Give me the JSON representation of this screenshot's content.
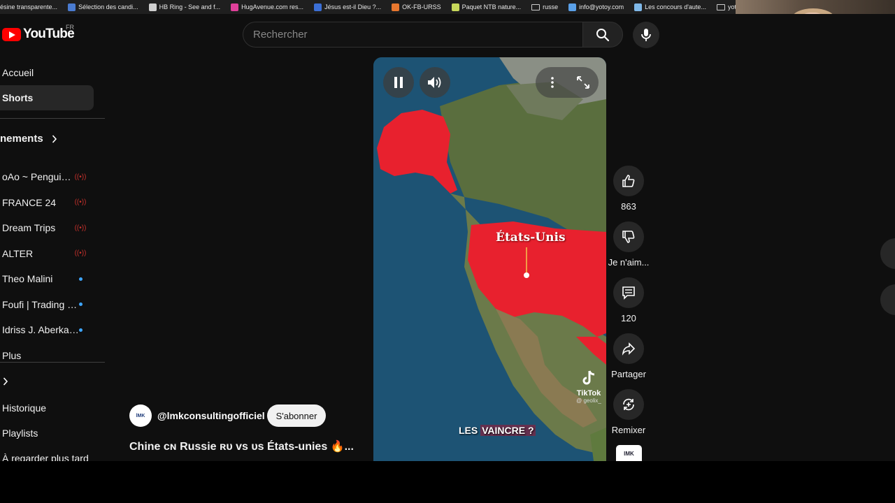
{
  "bookmarks": [
    {
      "label": "ésine transparente...",
      "color": "#6b6b6b"
    },
    {
      "label": "Sélection des candi...",
      "color": "#4a7bd0"
    },
    {
      "label": "HB Ring - See and f...",
      "color": "#cfcfcf"
    },
    {
      "label": "HugAvenue.com res...",
      "color": "#e0409a"
    },
    {
      "label": "Jésus est-il Dieu ?...",
      "color": "#3b6fd6"
    },
    {
      "label": "OK-FB-URSS",
      "color": "#e8772e"
    },
    {
      "label": "Paquet NTB nature...",
      "color": "#c7d85a"
    },
    {
      "label": "russe",
      "color": "folder"
    },
    {
      "label": "info@yotoy.com",
      "color": "#5aa0e8"
    },
    {
      "label": "Les concours d'aute...",
      "color": "#7fb8e8"
    },
    {
      "label": "yotoy",
      "color": "folder"
    },
    {
      "label": "",
      "color": "#e8e8e8"
    }
  ],
  "header": {
    "logo_text": "YouTube",
    "country": "FR",
    "search_placeholder": "Rechercher"
  },
  "sidebar": {
    "top_items": [
      {
        "label": "Accueil"
      },
      {
        "label": "Shorts"
      }
    ],
    "subscriptions_heading": "nements",
    "subscriptions": [
      {
        "label": "oAo ~ Penguin J...",
        "status": "live"
      },
      {
        "label": "FRANCE 24",
        "status": "live"
      },
      {
        "label": "Dream Trips",
        "status": "live"
      },
      {
        "label": "ALTER",
        "status": "live"
      },
      {
        "label": "Theo Malini",
        "status": "new"
      },
      {
        "label": "Foufi | Trading & ...",
        "status": "new"
      },
      {
        "label": "Idriss J. Aberkane",
        "status": "new"
      },
      {
        "label": "Plus",
        "status": ""
      }
    ],
    "you_items": [
      {
        "label": "Historique"
      },
      {
        "label": "Playlists"
      },
      {
        "label": "À regarder plus tard"
      }
    ]
  },
  "video": {
    "map_label": "États-Unis",
    "caption_plain": "LES ",
    "caption_highlight": "VAINCRE ?",
    "watermark_name": "TikTok",
    "watermark_handle": "@ geolix_"
  },
  "actions": {
    "like_count": "863",
    "dislike_label": "Je n'aim...",
    "comment_count": "120",
    "share_label": "Partager",
    "remix_label": "Remixer"
  },
  "channel": {
    "avatar_text": "lMK",
    "name": "@lmkconsultingofficiel",
    "subscribe_label": "S'abonner",
    "title": "Chine ᴄɴ Russie ʀᴜ vs ᴜs États-unies 🔥..."
  },
  "colors": {
    "accent": "#ff0000",
    "live": "#c4302b",
    "new_dot": "#3ea6ff",
    "map_highlight": "#e8212e"
  }
}
